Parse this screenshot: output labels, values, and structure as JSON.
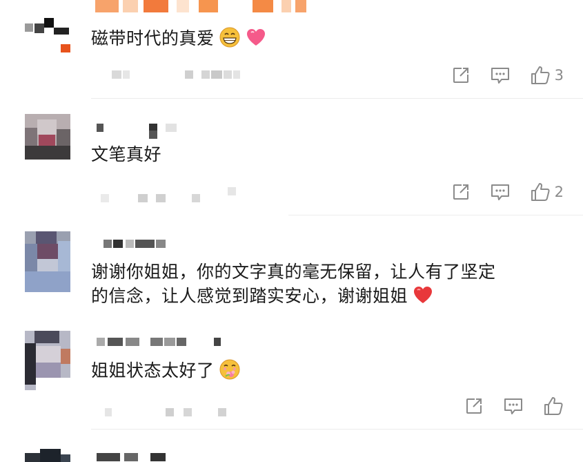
{
  "comments": [
    {
      "text": "磁带时代的真爱",
      "emojis": [
        "grin-emoji",
        "heart-emoji"
      ],
      "likes": "3",
      "has_comment_icon": true
    },
    {
      "text": "文笔真好",
      "emojis": [],
      "likes": "2",
      "has_comment_icon": true
    },
    {
      "text": "谢谢你姐姐，你的文字真的毫无保留，让人有了坚定的信念，让人感觉到踏实安心，谢谢姐姐",
      "text_line1": "谢谢你姐姐，你的文字真的毫无保留，让人有了坚定",
      "text_line2": "的信念，让人感觉到踏实安心，谢谢姐姐",
      "emojis": [
        "red-heart-emoji"
      ],
      "likes": "",
      "has_comment_icon": false
    },
    {
      "text": "姐姐状态太好了",
      "emojis": [
        "flower-hug-emoji"
      ],
      "likes": "",
      "has_comment_icon": true
    }
  ],
  "colors": {
    "text": "#1a1a1a",
    "icon": "#8a8a8a",
    "heart": "#e8383b",
    "emoji_yellow": "#f6c03b"
  }
}
